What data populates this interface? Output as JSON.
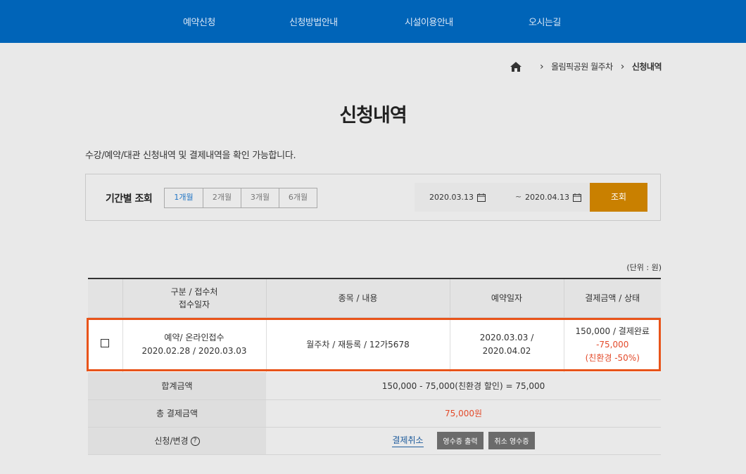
{
  "nav": {
    "items": [
      "예약신청",
      "신청방법안내",
      "시설이용안내",
      "오시는길"
    ]
  },
  "breadcrumb": {
    "home_icon": "home-icon",
    "level1": "올림픽공원 월주차",
    "current": "신청내역"
  },
  "page": {
    "title": "신청내역",
    "description": "수강/예약/대관 신청내역 및 결제내역을 확인 가능합니다."
  },
  "filter": {
    "label": "기간별 조회",
    "periods": [
      "1개월",
      "2개월",
      "3개월",
      "6개월"
    ],
    "selected_period": "1개월",
    "start_date": "2020.03.13",
    "end_date": "2020.04.13",
    "separator": "~",
    "search_label": "조회",
    "search_color": "#c98000"
  },
  "unit_label": "(단위 : 원)",
  "table": {
    "headers": {
      "col2_line1": "구분 / 접수처",
      "col2_line2": "접수일자",
      "col3": "종목 / 내용",
      "col4": "예약일자",
      "col5": "결제금액 / 상태"
    },
    "row": {
      "type": "예약/ 온라인접수",
      "received_dates": "2020.02.28 / 2020.03.03",
      "content": "월주차 / 재등록 / 12가5678",
      "reserve_start": "2020.03.03 /",
      "reserve_end": "2020.04.02",
      "amount_status": "150,000 / 결제완료",
      "discount": "-75,000",
      "discount_note": "(친환경 -50%)"
    }
  },
  "summary": {
    "total_label": "합계금액",
    "total_value": "150,000 - 75,000(친환경 할인) = 75,000",
    "final_label": "총 결제금액",
    "final_value": "75,000원",
    "change_label": "신청/변경",
    "help_icon": "help-circle-icon",
    "cancel_label": "결제취소",
    "receipt_label": "영수증 출력",
    "cancel_receipt_label": "취소 영수증"
  },
  "colors": {
    "nav_bg": "#0064b8",
    "highlight": "#e8541a",
    "accent_red": "#e34a2a"
  }
}
